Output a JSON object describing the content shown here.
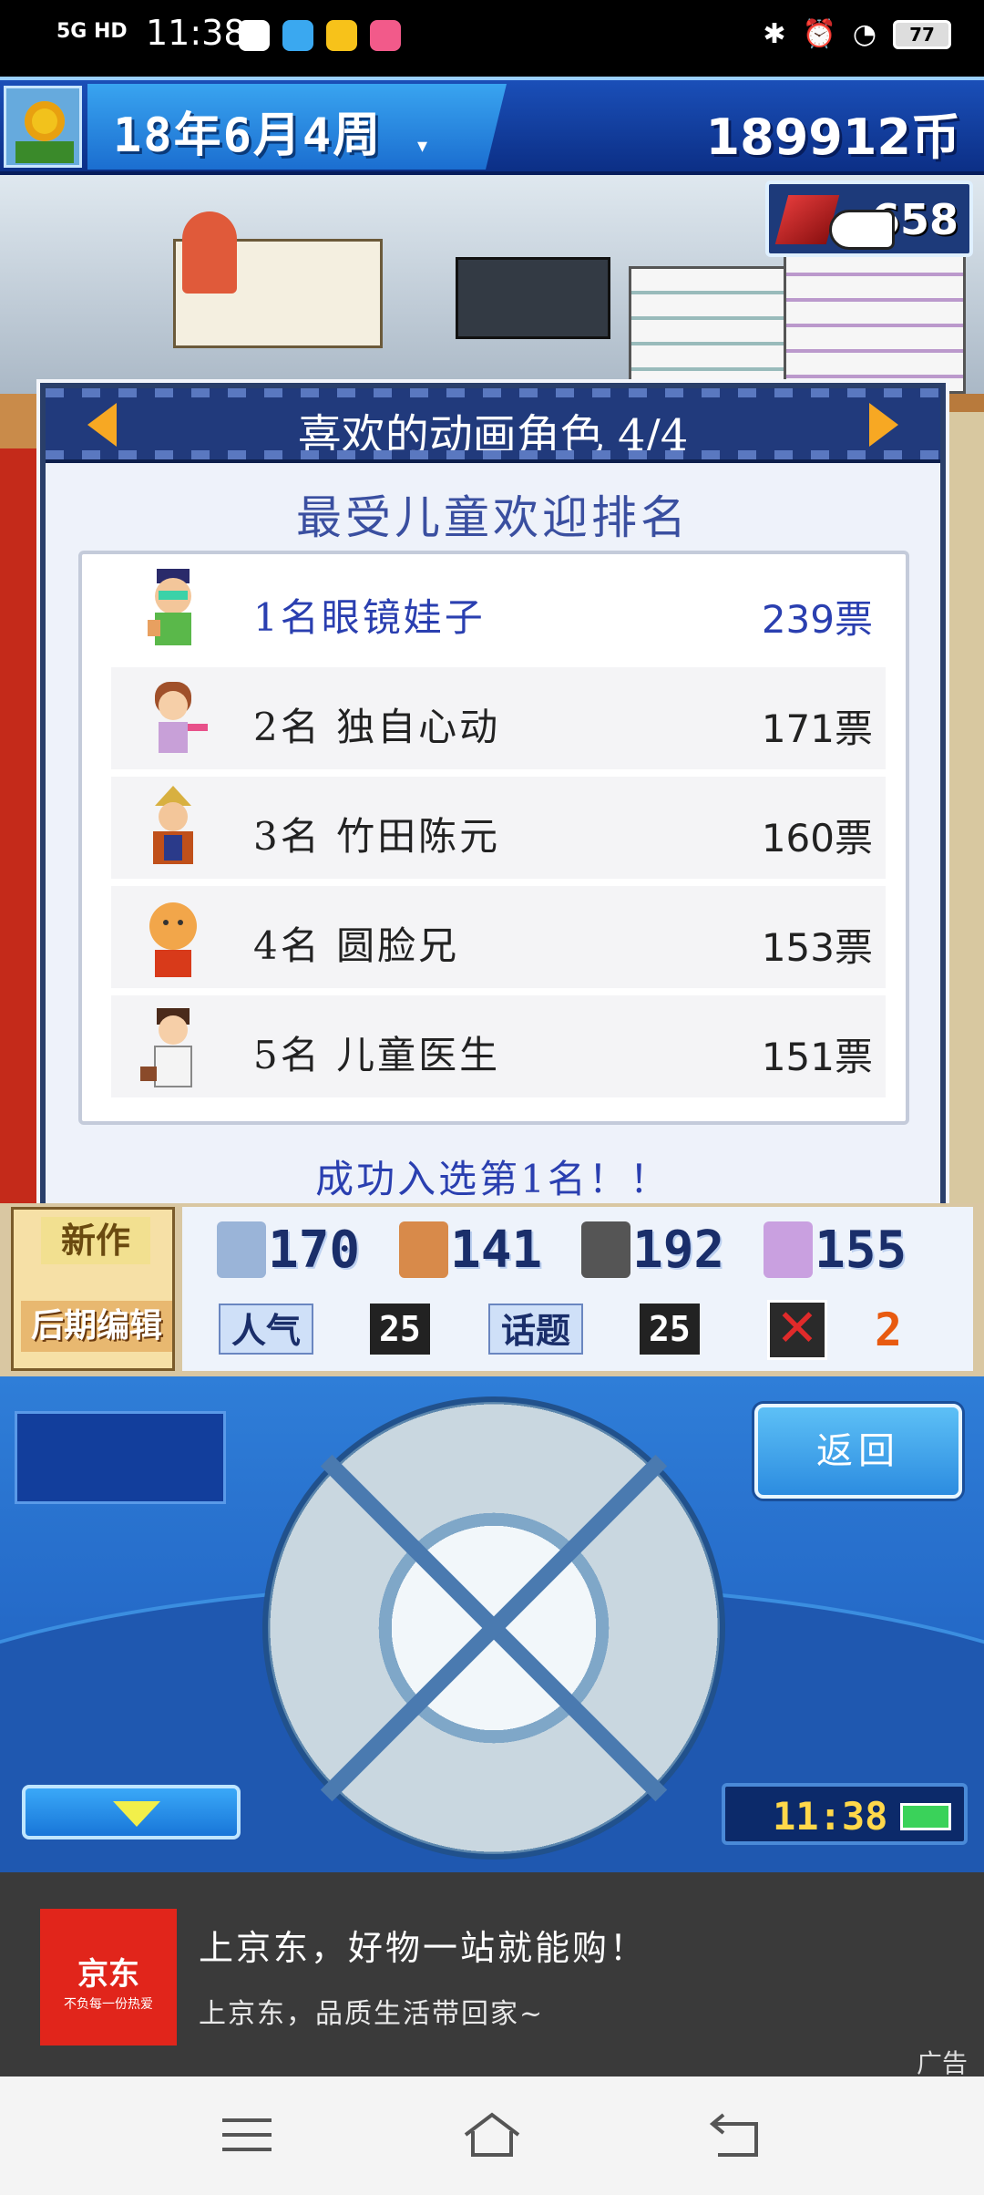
{
  "status_bar": {
    "network": "5G HD",
    "time": "11:38",
    "battery": "77"
  },
  "header": {
    "date": "18年6月4周",
    "coins": "189912币",
    "crystal_count": "658"
  },
  "dialog": {
    "title": "喜欢的动画角色 4/4",
    "subtitle": "最受儿童欢迎排名",
    "rankings": [
      {
        "name": "1名眼镜娃子",
        "votes": "239票"
      },
      {
        "name": "2名 独自心动",
        "votes": "171票"
      },
      {
        "name": "3名 竹田陈元",
        "votes": "160票"
      },
      {
        "name": "4名 圆脸兄",
        "votes": "153票"
      },
      {
        "name": "5名 儿童医生",
        "votes": "151票"
      }
    ],
    "footer": "成功入选第1名！！"
  },
  "stats": {
    "new_label": "新作",
    "edit_label": "后期编辑",
    "values": [
      "170",
      "141",
      "192",
      "155"
    ],
    "popularity_label": "人气",
    "popularity_value": "25",
    "topic_label": "话题",
    "topic_value": "25",
    "bugs_value": "2"
  },
  "controller": {
    "back_label": "返回",
    "clock": "11:38"
  },
  "ad": {
    "brand": "京东",
    "brand_slogan": "不负每一份热爱",
    "headline": "上京东，好物一站就能购！",
    "subline": "上京东，品质生活带回家~",
    "tag": "广告"
  },
  "colors": {
    "accent_blue": "#2a3fb0",
    "arrow_orange": "#f7a823",
    "jd_red": "#e1251b"
  }
}
